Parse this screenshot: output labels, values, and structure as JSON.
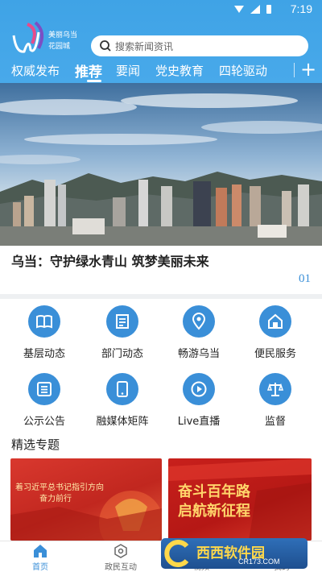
{
  "status_bar": {
    "time": "7:19"
  },
  "header": {
    "logo_alt": "美丽乌当花园城",
    "search_placeholder": "搜索新闻资讯",
    "tabs": [
      {
        "label": "权威发布"
      },
      {
        "label": "推荐"
      },
      {
        "label": "要闻"
      },
      {
        "label": "党史教育"
      },
      {
        "label": "四轮驱动"
      }
    ],
    "add_label": "+"
  },
  "banner": {
    "caption": "乌当：守护绿水青山 筑梦美丽未来",
    "page_indicator": "01"
  },
  "grid": {
    "items": [
      {
        "label": "基层动态",
        "icon": "book-icon"
      },
      {
        "label": "部门动态",
        "icon": "document-icon"
      },
      {
        "label": "畅游乌当",
        "icon": "location-pin-icon"
      },
      {
        "label": "便民服务",
        "icon": "home-icon"
      },
      {
        "label": "公示公告",
        "icon": "list-icon"
      },
      {
        "label": "融媒体矩阵",
        "icon": "phone-icon"
      },
      {
        "label": "Live直播",
        "icon": "play-icon"
      },
      {
        "label": "监督",
        "icon": "scale-icon"
      }
    ]
  },
  "featured": {
    "title": "精选专题",
    "cards": [
      {
        "text_line1": "着习近平总书记指引方向",
        "text_line2": "奋力前行"
      },
      {
        "text_line1": "奋斗百年路",
        "text_line2": "启航新征程"
      }
    ]
  },
  "bottom_nav": {
    "items": [
      {
        "label": "首页"
      },
      {
        "label": "政民互动"
      },
      {
        "label": "视频"
      },
      {
        "label": "我的"
      }
    ]
  },
  "watermark": {
    "text": "西西软件园",
    "sub": "CR173.COM"
  },
  "colors": {
    "header": "#3fa3e6",
    "accent": "#3a8fd8",
    "card_red": "#c8201c"
  }
}
